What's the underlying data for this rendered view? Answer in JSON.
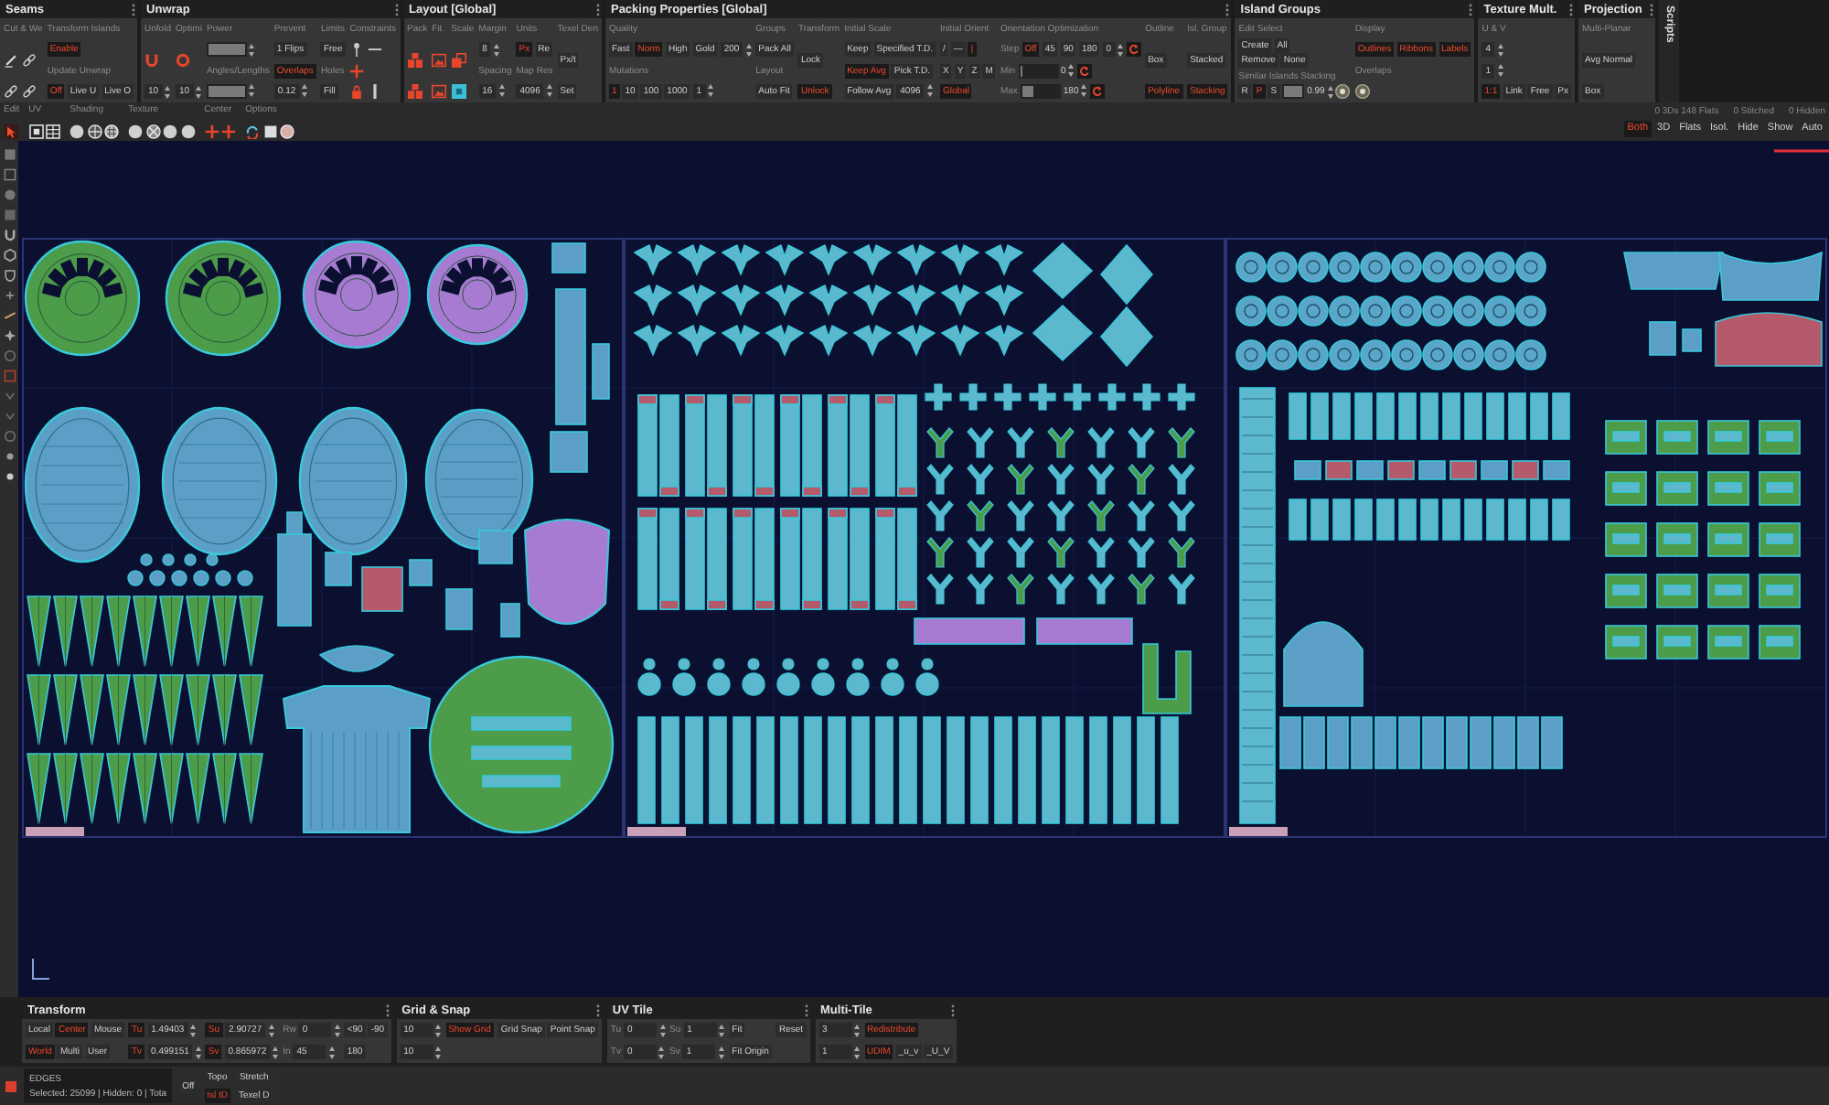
{
  "top_panels": [
    {
      "title": "Seams",
      "columns": [
        [
          [
            {
              "kind": "label",
              "text": "Cut & We"
            }
          ],
          [
            {
              "kind": "icon"
            },
            {
              "kind": "icon"
            }
          ],
          [
            {
              "kind": "icon"
            },
            {
              "kind": "icon"
            }
          ]
        ],
        [
          [
            {
              "kind": "label",
              "text": "Transform Islands"
            }
          ],
          [
            {
              "kind": "button",
              "text": "Enable",
              "on": true
            }
          ],
          [
            {
              "kind": "label",
              "text": "Update Unwrap"
            }
          ],
          [
            {
              "kind": "button",
              "text": "Off",
              "on": true
            },
            {
              "kind": "button",
              "text": "Live U",
              "on": false
            },
            {
              "kind": "button",
              "text": "Live O",
              "on": false
            }
          ]
        ]
      ]
    },
    {
      "title": "Unwrap",
      "columns": [
        [
          [
            {
              "kind": "label",
              "text": "Unfold"
            }
          ],
          [
            {
              "kind": "icon"
            }
          ],
          [
            {
              "kind": "field",
              "value": "10"
            }
          ]
        ],
        [
          [
            {
              "kind": "label",
              "text": "Optimi"
            }
          ],
          [
            {
              "kind": "icon"
            }
          ],
          [
            {
              "kind": "field",
              "value": "10"
            }
          ]
        ],
        [
          [
            {
              "kind": "label",
              "text": "Power"
            }
          ],
          [
            {
              "kind": "slider",
              "level": 1
            }
          ],
          [
            {
              "kind": "label",
              "text": "Angles/Lengths"
            }
          ],
          [
            {
              "kind": "slider",
              "level": 1
            }
          ]
        ],
        [
          [
            {
              "kind": "label",
              "text": "Prevent"
            }
          ],
          [
            {
              "kind": "button",
              "text": "1 Flips",
              "on": false
            }
          ],
          [
            {
              "kind": "button",
              "text": "Overlaps",
              "on": true
            }
          ],
          [
            {
              "kind": "field",
              "value": "0.12"
            }
          ]
        ],
        [
          [
            {
              "kind": "label",
              "text": "Limits"
            }
          ],
          [
            {
              "kind": "button",
              "text": "Free",
              "on": false
            }
          ],
          [
            {
              "kind": "label",
              "text": "Holes"
            }
          ],
          [
            {
              "kind": "button",
              "text": "Fill",
              "on": false
            }
          ]
        ],
        [
          [
            {
              "kind": "label",
              "text": "Constraints"
            }
          ],
          [
            {
              "kind": "icon"
            },
            {
              "kind": "icon"
            }
          ],
          [
            {
              "kind": "icon"
            }
          ],
          [
            {
              "kind": "icon"
            },
            {
              "kind": "icon"
            }
          ]
        ]
      ]
    },
    {
      "title": "Layout [Global]",
      "columns": [
        [
          [
            {
              "kind": "label",
              "text": "Pack"
            }
          ],
          [
            {
              "kind": "icon"
            }
          ],
          [
            {
              "kind": "icon"
            }
          ]
        ],
        [
          [
            {
              "kind": "label",
              "text": "Fit"
            }
          ],
          [
            {
              "kind": "icon"
            }
          ],
          [
            {
              "kind": "icon"
            }
          ]
        ],
        [
          [
            {
              "kind": "label",
              "text": "Scale"
            }
          ],
          [
            {
              "kind": "icon"
            }
          ],
          [
            {
              "kind": "icon"
            }
          ]
        ],
        [
          [
            {
              "kind": "label",
              "text": "Margin"
            }
          ],
          [
            {
              "kind": "field",
              "value": "8"
            }
          ],
          [
            {
              "kind": "label",
              "text": "Spacing"
            }
          ],
          [
            {
              "kind": "field",
              "value": "16"
            }
          ]
        ],
        [
          [
            {
              "kind": "label",
              "text": "Units"
            }
          ],
          [
            {
              "kind": "button",
              "text": "Px",
              "on": true
            },
            {
              "kind": "button",
              "text": "Re",
              "on": false
            }
          ],
          [
            {
              "kind": "label",
              "text": "Map Res"
            }
          ],
          [
            {
              "kind": "field",
              "value": "4096"
            }
          ]
        ],
        [
          [
            {
              "kind": "label",
              "text": "Texel Den"
            }
          ],
          [
            {
              "kind": "button",
              "text": "Px/t",
              "on": false
            }
          ],
          [
            {
              "kind": "button",
              "text": "Set",
              "on": false
            }
          ]
        ]
      ]
    },
    {
      "title": "Packing Properties [Global]",
      "columns": [
        [
          [
            {
              "kind": "label",
              "text": "Quality"
            }
          ],
          [
            {
              "kind": "button",
              "text": "Fast",
              "on": false
            },
            {
              "kind": "button",
              "text": "Norm",
              "on": true
            },
            {
              "kind": "button",
              "text": "High",
              "on": false
            },
            {
              "kind": "button",
              "text": "Gold",
              "on": false
            },
            {
              "kind": "field",
              "value": "200"
            }
          ],
          [
            {
              "kind": "label",
              "text": "Mutations"
            }
          ],
          [
            {
              "kind": "button",
              "text": "1",
              "on": true
            },
            {
              "kind": "button",
              "text": "10",
              "on": false
            },
            {
              "kind": "button",
              "text": "100",
              "on": false
            },
            {
              "kind": "button",
              "text": "1000",
              "on": false
            },
            {
              "kind": "field",
              "value": "1"
            }
          ]
        ],
        [
          [
            {
              "kind": "label",
              "text": "Groups"
            }
          ],
          [
            {
              "kind": "button",
              "text": "Pack All",
              "on": false
            }
          ],
          [
            {
              "kind": "label",
              "text": "Layout"
            }
          ],
          [
            {
              "kind": "button",
              "text": "Auto Fit",
              "on": false
            }
          ]
        ],
        [
          [
            {
              "kind": "label",
              "text": "Transform"
            }
          ],
          [
            {
              "kind": "button",
              "text": "Lock",
              "on": false
            }
          ],
          [
            {
              "kind": "button",
              "text": "Unlock",
              "on": true
            }
          ]
        ],
        [
          [
            {
              "kind": "label",
              "text": "Initial Scale"
            }
          ],
          [
            {
              "kind": "button",
              "text": "Keep",
              "on": false
            },
            {
              "kind": "button",
              "text": "Specified T.D.",
              "on": false
            }
          ],
          [
            {
              "kind": "button",
              "text": "Keep Avg",
              "on": true
            },
            {
              "kind": "button",
              "text": "Pick T.D.",
              "on": false
            }
          ],
          [
            {
              "kind": "button",
              "text": "Follow Avg",
              "on": false
            },
            {
              "kind": "field",
              "value": "4096"
            }
          ]
        ],
        [
          [
            {
              "kind": "label",
              "text": "Initial Orient"
            }
          ],
          [
            {
              "kind": "button",
              "text": "/",
              "on": false
            },
            {
              "kind": "button",
              "text": "—",
              "on": false
            },
            {
              "kind": "button",
              "text": "|",
              "on": true
            }
          ],
          [
            {
              "kind": "button",
              "text": "X",
              "on": false
            },
            {
              "kind": "button",
              "text": "Y",
              "on": false
            },
            {
              "kind": "button",
              "text": "Z",
              "on": false
            },
            {
              "kind": "button",
              "text": "M",
              "on": false
            }
          ],
          [
            {
              "kind": "button",
              "text": "Global",
              "on": true
            }
          ]
        ],
        [
          [
            {
              "kind": "label",
              "text": "Orientation Optimization"
            }
          ],
          [
            {
              "kind": "label",
              "text": "Step"
            },
            {
              "kind": "button",
              "text": "Off",
              "on": true
            },
            {
              "kind": "button",
              "text": "45",
              "on": false
            },
            {
              "kind": "button",
              "text": "90",
              "on": false
            },
            {
              "kind": "button",
              "text": "180",
              "on": false
            },
            {
              "kind": "field",
              "value": "0"
            },
            {
              "kind": "icon"
            }
          ],
          [
            {
              "kind": "label",
              "text": "Min"
            },
            {
              "kind": "slider",
              "level": 0,
              "value": "0"
            },
            {
              "kind": "icon"
            }
          ],
          [
            {
              "kind": "label",
              "text": "Max"
            },
            {
              "kind": "slider",
              "level": 0.3,
              "value": "180"
            },
            {
              "kind": "icon"
            }
          ]
        ],
        [
          [
            {
              "kind": "label",
              "text": "Outline"
            }
          ],
          [
            {
              "kind": "button",
              "text": "Box",
              "on": false
            }
          ],
          [
            {
              "kind": "button",
              "text": "Polyline",
              "on": true
            }
          ]
        ],
        [
          [
            {
              "kind": "label",
              "text": "Isl. Group"
            }
          ],
          [
            {
              "kind": "button",
              "text": "Stacked",
              "on": false
            }
          ],
          [
            {
              "kind": "button",
              "text": "Stacking",
              "on": true
            }
          ]
        ]
      ]
    },
    {
      "title": "Island Groups",
      "columns": [
        [
          [
            {
              "kind": "label",
              "text": "Edit"
            },
            {
              "kind": "label",
              "text": "Select"
            }
          ],
          [
            {
              "kind": "button",
              "text": "Create",
              "on": false
            },
            {
              "kind": "button",
              "text": "All",
              "on": false
            }
          ],
          [
            {
              "kind": "button",
              "text": "Remove",
              "on": false
            },
            {
              "kind": "button",
              "text": "None",
              "on": false
            }
          ],
          [
            {
              "kind": "label",
              "text": "Similar Islands Stacking"
            }
          ],
          [
            {
              "kind": "button",
              "text": "R",
              "on": false
            },
            {
              "kind": "button",
              "text": "P",
              "on": true
            },
            {
              "kind": "button",
              "text": "S",
              "on": false
            },
            {
              "kind": "slider",
              "level": 1,
              "value": "0.99"
            },
            {
              "kind": "icon"
            }
          ]
        ],
        [
          [
            {
              "kind": "label",
              "text": "Display"
            }
          ],
          [
            {
              "kind": "button",
              "text": "Outlines",
              "on": true
            },
            {
              "kind": "button",
              "text": "Ribbons",
              "on": true
            },
            {
              "kind": "button",
              "text": "Labels",
              "on": true
            }
          ],
          [
            {
              "kind": "label",
              "text": "Overlaps"
            }
          ],
          [
            {
              "kind": "icon"
            }
          ]
        ]
      ]
    },
    {
      "title": "Texture Mult.",
      "columns": [
        [
          [
            {
              "kind": "label",
              "text": "U & V"
            }
          ],
          [
            {
              "kind": "field",
              "value": "4"
            }
          ],
          [
            {
              "kind": "field",
              "value": "1"
            }
          ],
          [
            {
              "kind": "button",
              "text": "1:1",
              "on": true
            },
            {
              "kind": "button",
              "text": "Link",
              "on": false
            },
            {
              "kind": "button",
              "text": "Free",
              "on": false
            },
            {
              "kind": "button",
              "text": "Px",
              "on": false
            }
          ]
        ]
      ]
    },
    {
      "title": "Projection",
      "columns": [
        [
          [
            {
              "kind": "label",
              "text": "Multi-Planar"
            }
          ],
          [
            {
              "kind": "button",
              "text": "Avg Normal",
              "on": false
            }
          ],
          [
            {
              "kind": "button",
              "text": "Box",
              "on": false
            }
          ]
        ]
      ]
    }
  ],
  "side_tab": {
    "label": "Scripts"
  },
  "view_toolbar": {
    "groups": [
      {
        "label": "Edit"
      },
      {
        "label": "UV"
      },
      {
        "label": "Shading"
      },
      {
        "label": "Texture"
      },
      {
        "label": "Center"
      },
      {
        "label": "Options"
      }
    ],
    "stats": [
      "0 3Ds 148 Flats",
      "0 Stitched",
      "0 Hidden"
    ],
    "view_buttons": [
      {
        "label": "Both",
        "selected": true
      },
      {
        "label": "3D",
        "selected": false
      },
      {
        "label": "Flats",
        "selected": false
      },
      {
        "label": "Isol.",
        "selected": false
      },
      {
        "label": "Hide",
        "selected": false
      },
      {
        "label": "Show",
        "selected": false
      },
      {
        "label": "Auto",
        "selected": false
      }
    ]
  },
  "bottom_panels": [
    {
      "title": "Transform",
      "columns": [
        [
          [
            {
              "kind": "button",
              "text": "Local",
              "on": false
            },
            {
              "kind": "button",
              "text": "Center",
              "on": true
            },
            {
              "kind": "button",
              "text": "Mouse",
              "on": false
            }
          ],
          [
            {
              "kind": "button",
              "text": "World",
              "on": true
            },
            {
              "kind": "button",
              "text": "Multi",
              "on": false
            },
            {
              "kind": "button",
              "text": "User",
              "on": false
            }
          ]
        ],
        [
          [
            {
              "kind": "button",
              "text": "Tu",
              "on": true
            },
            {
              "kind": "field",
              "value": "1.49403"
            }
          ],
          [
            {
              "kind": "button",
              "text": "Tv",
              "on": true
            },
            {
              "kind": "field",
              "value": "0.499151"
            }
          ]
        ],
        [
          [
            {
              "kind": "button",
              "text": "Su",
              "on": true
            },
            {
              "kind": "field",
              "value": "2.90727"
            }
          ],
          [
            {
              "kind": "button",
              "text": "Sv",
              "on": true
            },
            {
              "kind": "field",
              "value": "0.865972"
            }
          ]
        ],
        [
          [
            {
              "kind": "label",
              "text": "Rw"
            },
            {
              "kind": "field",
              "value": "0"
            }
          ],
          [
            {
              "kind": "label",
              "text": "In"
            },
            {
              "kind": "field",
              "value": "45"
            }
          ]
        ],
        [
          [
            {
              "kind": "button",
              "text": "<90",
              "on": false
            },
            {
              "kind": "button",
              "text": "-90",
              "on": false
            }
          ],
          [
            {
              "kind": "button",
              "text": "180",
              "on": false
            }
          ]
        ]
      ]
    },
    {
      "title": "Grid & Snap",
      "columns": [
        [
          [
            {
              "kind": "field",
              "value": "10"
            }
          ],
          [
            {
              "kind": "field",
              "value": "10"
            }
          ]
        ],
        [
          [
            {
              "kind": "button",
              "text": "Show Grid",
              "on": true
            }
          ]
        ],
        [
          [
            {
              "kind": "button",
              "text": "Grid Snap",
              "on": false
            },
            {
              "kind": "button",
              "text": "Point Snap",
              "on": false
            }
          ]
        ]
      ]
    },
    {
      "title": "UV Tile",
      "columns": [
        [
          [
            {
              "kind": "label",
              "text": "Tu"
            },
            {
              "kind": "field",
              "value": "0"
            }
          ],
          [
            {
              "kind": "label",
              "text": "Tv"
            },
            {
              "kind": "field",
              "value": "0"
            }
          ]
        ],
        [
          [
            {
              "kind": "label",
              "text": "Su"
            },
            {
              "kind": "field",
              "value": "1"
            }
          ],
          [
            {
              "kind": "label",
              "text": "Sv"
            },
            {
              "kind": "field",
              "value": "1"
            }
          ]
        ],
        [
          [
            {
              "kind": "button",
              "text": "Fit",
              "on": false
            }
          ],
          [
            {
              "kind": "button",
              "text": "Fit Origin",
              "on": false
            }
          ]
        ],
        [
          [
            {
              "kind": "button",
              "text": "Reset",
              "on": false
            }
          ]
        ]
      ]
    },
    {
      "title": "Multi-Tile",
      "columns": [
        [
          [
            {
              "kind": "field",
              "value": "3"
            }
          ],
          [
            {
              "kind": "field",
              "value": "1"
            }
          ]
        ],
        [
          [
            {
              "kind": "button",
              "text": "Redistribute",
              "on": true
            }
          ],
          [
            {
              "kind": "button",
              "text": "UDIM",
              "on": true
            },
            {
              "kind": "button",
              "text": "_u_v",
              "on": false
            },
            {
              "kind": "button",
              "text": "_U_V",
              "on": false
            }
          ]
        ]
      ]
    }
  ],
  "status_bar": {
    "mode": "EDGES",
    "selection": "Selected: 25099 | Hidden: 0 | Tota",
    "toggle": "Off",
    "buttons": [
      {
        "label": "Topo",
        "selected": false
      },
      {
        "label": "Stretch",
        "selected": false
      },
      {
        "label": "Isl ID",
        "selected": true
      },
      {
        "label": "Texel D",
        "selected": false
      }
    ]
  }
}
